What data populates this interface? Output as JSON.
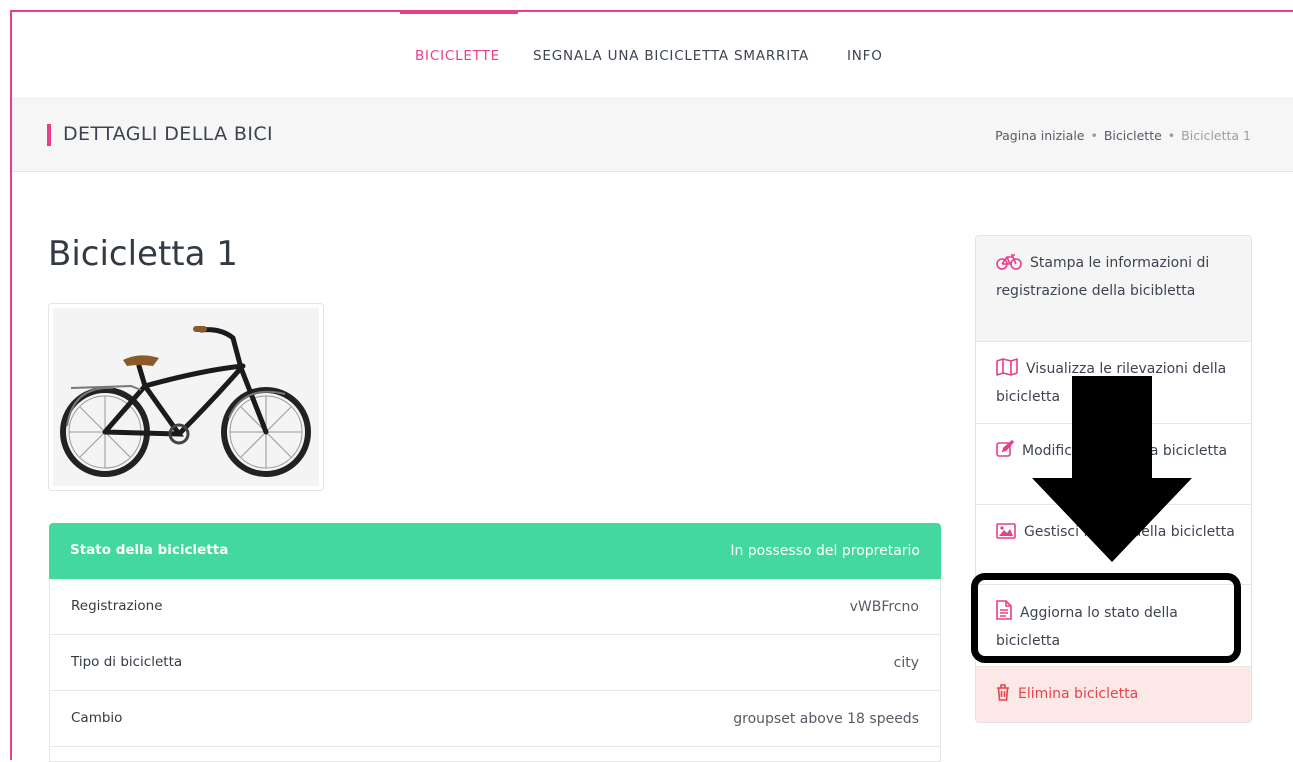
{
  "nav": {
    "items": [
      {
        "label": "BICICLETTE",
        "active": true
      },
      {
        "label": "SEGNALA UNA BICICLETTA SMARRITA",
        "active": false
      },
      {
        "label": "INFO",
        "active": false
      }
    ]
  },
  "titlebar": {
    "title": "DETTAGLI DELLA BICI",
    "breadcrumb": [
      "Pagina iniziale",
      "Biciclette",
      "Bicicletta 1"
    ]
  },
  "bike": {
    "title": "Bicicletta 1"
  },
  "details": {
    "status": {
      "label": "Stato della bicicletta",
      "value": "In possesso del propretario"
    },
    "rows": [
      {
        "label": "Registrazione",
        "value": "vWBFrcno"
      },
      {
        "label": "Tipo di bicicletta",
        "value": "city"
      },
      {
        "label": "Cambio",
        "value": "groupset above 18 speeds"
      }
    ]
  },
  "sidebar": {
    "items": [
      {
        "label": "Stampa le informazioni di registrazione della bicibletta",
        "icon": "bicycle-icon"
      },
      {
        "label": "Visualizza le rilevazioni della bicicletta",
        "icon": "map-icon"
      },
      {
        "label": "Modifica i dati della bicicletta",
        "icon": "edit-icon"
      },
      {
        "label": "Gestisci le foto della bicicletta",
        "icon": "image-icon"
      },
      {
        "label": "Aggiorna lo stato della bicicletta",
        "icon": "document-icon"
      },
      {
        "label": "Elimina bicicletta",
        "icon": "trash-icon"
      }
    ]
  },
  "colors": {
    "accent": "#e83e8c",
    "status_green": "#43d89d",
    "danger": "#e8434a",
    "danger_bg": "#fde8e8"
  }
}
